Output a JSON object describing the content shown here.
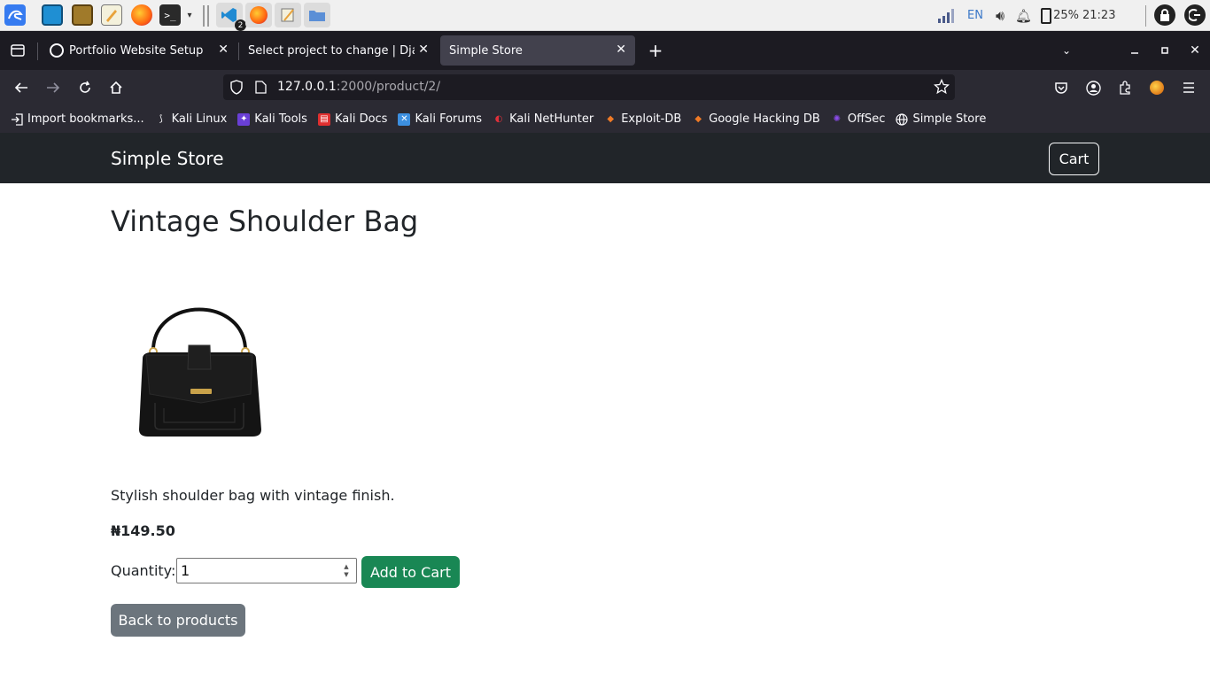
{
  "taskbar": {
    "icons": [
      "kali-menu-icon",
      "desktop-icon",
      "files-icon",
      "text-editor-icon",
      "firefox-icon",
      "terminal-icon",
      "vscode-icon",
      "firefox-window-icon",
      "notes-window-icon",
      "folder-window-icon"
    ],
    "vscode_badge": "2",
    "language": "EN",
    "battery": "25%",
    "clock": "21:23"
  },
  "browser": {
    "tabs": [
      {
        "title": "Portfolio Website Setup",
        "active": false
      },
      {
        "title": "Select project to change | Dja",
        "active": false
      },
      {
        "title": "Simple Store",
        "active": true
      }
    ],
    "url": {
      "host": "127.0.0.1",
      "rest": ":2000/product/2/"
    },
    "bookmarks": [
      {
        "label": "Import bookmarks...",
        "icon": "import-icon",
        "color": "#fbfbfe"
      },
      {
        "label": "Kali Linux",
        "icon": "kali-dragon-icon",
        "color": "#fbfbfe"
      },
      {
        "label": "Kali Tools",
        "icon": "kali-tools-icon",
        "color": "#c54cf0"
      },
      {
        "label": "Kali Docs",
        "icon": "kali-docs-icon",
        "color": "#e02f2f"
      },
      {
        "label": "Kali Forums",
        "icon": "kali-forums-icon",
        "color": "#3c8fe0"
      },
      {
        "label": "Kali NetHunter",
        "icon": "nethunter-icon",
        "color": "#e0303a"
      },
      {
        "label": "Exploit-DB",
        "icon": "exploit-db-icon",
        "color": "#f07a26"
      },
      {
        "label": "Google Hacking DB",
        "icon": "ghdb-icon",
        "color": "#f07a26"
      },
      {
        "label": "OffSec",
        "icon": "offsec-icon",
        "color": "#8a4be8"
      },
      {
        "label": "Simple Store",
        "icon": "globe-icon",
        "color": "#fbfbfe"
      }
    ]
  },
  "page": {
    "brand": "Simple Store",
    "cart_label": "Cart",
    "product": {
      "title": "Vintage Shoulder Bag",
      "description": "Stylish shoulder bag with vintage finish.",
      "price": "₦149.50"
    },
    "quantity_label": "Quantity:",
    "quantity_value": "1",
    "add_to_cart_label": "Add to Cart",
    "back_label": "Back to products"
  },
  "colors": {
    "navbar": "#212529",
    "success": "#198754",
    "secondary": "#6c757d"
  }
}
